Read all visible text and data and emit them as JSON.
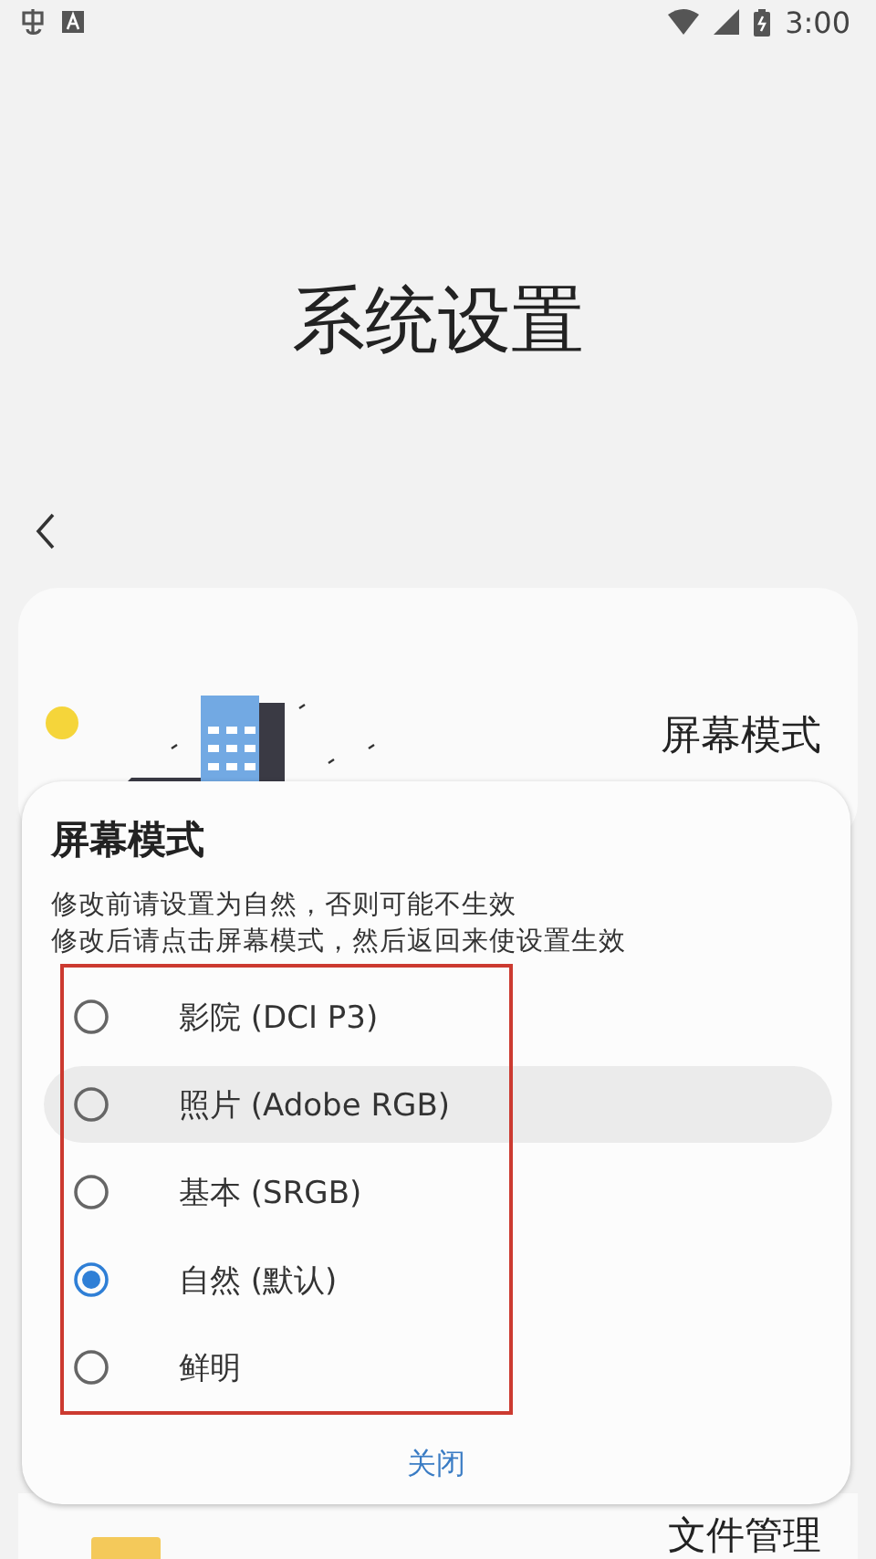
{
  "status_bar": {
    "time": "3:00"
  },
  "page": {
    "title": "系统设置"
  },
  "cards": [
    {
      "title": "屏幕模式"
    },
    {
      "title": "文件管理"
    }
  ],
  "dialog": {
    "title": "屏幕模式",
    "notes": [
      "修改前请设置为自然，否则可能不生效",
      "修改后请点击屏幕模式，然后返回来使设置生效"
    ],
    "options": [
      {
        "label": "影院 (DCI P3)",
        "selected": false,
        "highlighted": false
      },
      {
        "label": "照片 (Adobe RGB)",
        "selected": false,
        "highlighted": true
      },
      {
        "label": "基本 (SRGB)",
        "selected": false,
        "highlighted": false
      },
      {
        "label": "自然 (默认)",
        "selected": true,
        "highlighted": false
      },
      {
        "label": "鲜明",
        "selected": false,
        "highlighted": false
      }
    ],
    "close_button": "关闭"
  }
}
